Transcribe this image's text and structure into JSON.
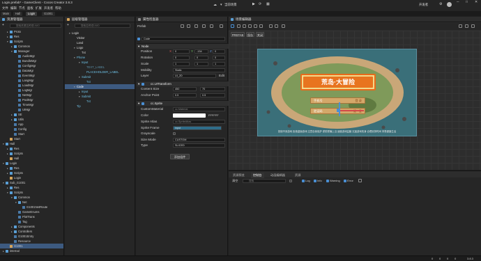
{
  "window": {
    "title": "Login.prefab* - GameClient - Cocos Creator 3.8.3",
    "controls": [
      "─",
      "□",
      "✕"
    ]
  },
  "menu": [
    "文件",
    "编辑",
    "节点",
    "面板",
    "扩展",
    "开发者",
    "帮助"
  ],
  "toolbar": {
    "preview_target": "当前场景",
    "account": "开发者"
  },
  "project_tabs": [
    {
      "label": "Main",
      "active": false
    },
    {
      "label": "Hall",
      "active": false
    },
    {
      "label": "Login",
      "active": true
    },
    {
      "label": "G1001",
      "active": false
    }
  ],
  "assets": {
    "title": "资源管理器",
    "search_placeholder": "搜索资源名称或UUID",
    "items": [
      {
        "label": "Proto",
        "type": "folder",
        "indent": 1,
        "arrow": "▸"
      },
      {
        "label": "Res",
        "type": "folder",
        "indent": 1,
        "arrow": "▸"
      },
      {
        "label": "Scripts",
        "type": "folder",
        "indent": 1,
        "arrow": "▾"
      },
      {
        "label": "Common",
        "type": "folder",
        "indent": 2,
        "arrow": "▸"
      },
      {
        "label": "Manager",
        "type": "folder",
        "indent": 2,
        "arrow": "▾"
      },
      {
        "label": "AudioMgr",
        "type": "file",
        "indent": 3,
        "arrow": ""
      },
      {
        "label": "BundleMgr",
        "type": "file",
        "indent": 3,
        "arrow": ""
      },
      {
        "label": "ConfigMgr",
        "type": "file",
        "indent": 3,
        "arrow": ""
      },
      {
        "label": "DataMgr",
        "type": "file",
        "indent": 3,
        "arrow": ""
      },
      {
        "label": "EventMgr",
        "type": "file",
        "indent": 3,
        "arrow": ""
      },
      {
        "label": "LangMgr",
        "type": "file",
        "indent": 3,
        "arrow": ""
      },
      {
        "label": "LoadMgr",
        "type": "file",
        "indent": 3,
        "arrow": ""
      },
      {
        "label": "LogMgr",
        "type": "file",
        "indent": 3,
        "arrow": ""
      },
      {
        "label": "NetMgr",
        "type": "file",
        "indent": 3,
        "arrow": ""
      },
      {
        "label": "PoolMgr",
        "type": "file",
        "indent": 3,
        "arrow": ""
      },
      {
        "label": "TimeMgr",
        "type": "file",
        "indent": 3,
        "arrow": ""
      },
      {
        "label": "UIMgr",
        "type": "file",
        "indent": 3,
        "arrow": ""
      },
      {
        "label": "SE",
        "type": "folder",
        "indent": 2,
        "arrow": "▸"
      },
      {
        "label": "Utils",
        "type": "folder",
        "indent": 2,
        "arrow": "▸"
      },
      {
        "label": "App",
        "type": "file",
        "indent": 2,
        "arrow": ""
      },
      {
        "label": "Config",
        "type": "file",
        "indent": 2,
        "arrow": ""
      },
      {
        "label": "Start",
        "type": "file",
        "indent": 2,
        "arrow": ""
      },
      {
        "label": "Start",
        "type": "scene",
        "indent": 1,
        "arrow": ""
      },
      {
        "label": "Hall",
        "type": "folder",
        "indent": 0,
        "arrow": "▾"
      },
      {
        "label": "Res",
        "type": "folder",
        "indent": 1,
        "arrow": "▸"
      },
      {
        "label": "Scripts",
        "type": "folder",
        "indent": 1,
        "arrow": "▸"
      },
      {
        "label": "Hall",
        "type": "scene",
        "indent": 1,
        "arrow": ""
      },
      {
        "label": "Login",
        "type": "folder",
        "indent": 0,
        "arrow": "▾"
      },
      {
        "label": "Res",
        "type": "folder",
        "indent": 1,
        "arrow": "▸"
      },
      {
        "label": "Scripts",
        "type": "folder",
        "indent": 1,
        "arrow": "▸"
      },
      {
        "label": "Login",
        "type": "scene",
        "indent": 1,
        "arrow": ""
      },
      {
        "label": "Sub_G1001",
        "type": "folder",
        "indent": 0,
        "arrow": "▾"
      },
      {
        "label": "Res",
        "type": "folder",
        "indent": 1,
        "arrow": "▸"
      },
      {
        "label": "Scripts",
        "type": "folder",
        "indent": 1,
        "arrow": "▾"
      },
      {
        "label": "Common",
        "type": "folder",
        "indent": 2,
        "arrow": "▾"
      },
      {
        "label": "Net",
        "type": "folder",
        "indent": 3,
        "arrow": "▾"
      },
      {
        "label": "G1001NetRoute",
        "type": "file",
        "indent": 4,
        "arrow": ""
      },
      {
        "label": "GameEnums",
        "type": "file",
        "indent": 3,
        "arrow": ""
      },
      {
        "label": "PlotTrans",
        "type": "file",
        "indent": 3,
        "arrow": ""
      },
      {
        "label": "Tag",
        "type": "file",
        "indent": 3,
        "arrow": ""
      },
      {
        "label": "Components",
        "type": "folder",
        "indent": 2,
        "arrow": "▸"
      },
      {
        "label": "Controllers",
        "type": "folder",
        "indent": 2,
        "arrow": "▸"
      },
      {
        "label": "G1001Entry",
        "type": "file",
        "indent": 2,
        "arrow": ""
      },
      {
        "label": "Resource",
        "type": "file",
        "indent": 2,
        "arrow": ""
      },
      {
        "label": "G1001",
        "type": "scene",
        "indent": 1,
        "arrow": "",
        "selected": true
      },
      {
        "label": "internal",
        "type": "folder",
        "indent": 0,
        "arrow": "▸"
      }
    ]
  },
  "hierarchy": {
    "title": "层级管理器",
    "search_placeholder": "搜索名称或UUID",
    "items": [
      {
        "label": "Login",
        "indent": 0,
        "arrow": "▾",
        "color": "#dddddd"
      },
      {
        "label": "Visitor",
        "indent": 1,
        "arrow": "",
        "color": "#dddddd"
      },
      {
        "label": "Land",
        "indent": 1,
        "arrow": "",
        "color": "#dddddd"
      },
      {
        "label": "Logo",
        "indent": 1,
        "arrow": "▾",
        "color": "#dddddd"
      },
      {
        "label": "Txt",
        "indent": 2,
        "arrow": "",
        "color": "#dddddd"
      },
      {
        "label": "Phone",
        "indent": 1,
        "arrow": "▾",
        "color": "#6fc3e8"
      },
      {
        "label": "Input",
        "indent": 2,
        "arrow": "▾",
        "color": "#6fc3e8"
      },
      {
        "label": "TEXT_LABEL",
        "indent": 3,
        "arrow": "",
        "color": "#5a8fa8"
      },
      {
        "label": "PLACEHOLDER_LABEL",
        "indent": 3,
        "arrow": "",
        "color": "#6fc3e8"
      },
      {
        "label": "Submit",
        "indent": 2,
        "arrow": "▾",
        "color": "#6fc3e8"
      },
      {
        "label": "Txt",
        "indent": 3,
        "arrow": "",
        "color": "#6fc3e8"
      },
      {
        "label": "Code",
        "indent": 1,
        "arrow": "▾",
        "color": "#ffffff",
        "selected": true
      },
      {
        "label": "Input",
        "indent": 2,
        "arrow": "▸",
        "color": "#6fc3e8"
      },
      {
        "label": "Submit",
        "indent": 2,
        "arrow": "▾",
        "color": "#6fc3e8"
      },
      {
        "label": "Txt",
        "indent": 3,
        "arrow": "",
        "color": "#6fc3e8"
      },
      {
        "label": "Tip",
        "indent": 1,
        "arrow": "",
        "color": "#6fc3e8"
      }
    ]
  },
  "inspector": {
    "title": "属性检查器",
    "prefab_label": "Prefab",
    "node_name": "Code",
    "node_section": "Node",
    "position": {
      "label": "Position",
      "x": "0",
      "y": "-134",
      "z": "0"
    },
    "rotation": {
      "label": "Rotation",
      "x": "0",
      "y": "0",
      "z": "0"
    },
    "scale": {
      "label": "Scale",
      "x": "1",
      "y": "1",
      "z": "1"
    },
    "mobility": {
      "label": "Mobility",
      "value": "Static"
    },
    "layer": {
      "label": "Layer",
      "value": "UI_2D",
      "btn": "Edit"
    },
    "uitransform": {
      "title": "cc.UITransform",
      "content_size": {
        "label": "Content Size",
        "w": "450",
        "h": "70"
      },
      "anchor_point": {
        "label": "Anchor Point",
        "x": "0.5",
        "y": "0.5"
      }
    },
    "sprite": {
      "title": "cc.Sprite",
      "custom_material": {
        "label": "CustomMaterial",
        "value": "cc.Material"
      },
      "color": {
        "label": "Color",
        "value": "FFFFFF"
      },
      "sprite_atlas": {
        "label": "Sprite Atlas",
        "value": "cc.SpriteAtlas"
      },
      "sprite_frame": {
        "label": "Sprite Frame",
        "value": "input"
      },
      "grayscale": {
        "label": "Grayscale"
      },
      "size_mode": {
        "label": "Size Mode",
        "value": "CUSTOM"
      },
      "type": {
        "label": "Type",
        "value": "SLICED"
      }
    },
    "add_component": "添加组件"
  },
  "scene": {
    "title": "场景编辑器",
    "mode_btns": [
      "PREFAB",
      "保存",
      "关闭"
    ],
    "game_title": "荒岛·大冒险",
    "phone_placeholder": "手机号",
    "phone_btn": "登 录",
    "code_placeholder": "验证码",
    "code_btn": "一键 · 登",
    "footer_text": "抵制不良游戏 拒绝盗版游戏 注意自我保护 谨防受骗上当 适度游戏益脑 沉迷游戏伤身 合理安排时间 享受健康生活"
  },
  "console": {
    "tabs": [
      {
        "label": "资源预览",
        "active": false
      },
      {
        "label": "控制台",
        "active": true
      },
      {
        "label": "动画编辑器",
        "active": false
      },
      {
        "label": "资源",
        "active": false
      }
    ],
    "clear": "清空",
    "search_placeholder": "搜索",
    "filters": [
      "Log",
      "Info",
      "Warning",
      "Error"
    ]
  },
  "status": {
    "counts": [
      "0",
      "0",
      "0",
      "0"
    ],
    "version": "3.8.3"
  }
}
